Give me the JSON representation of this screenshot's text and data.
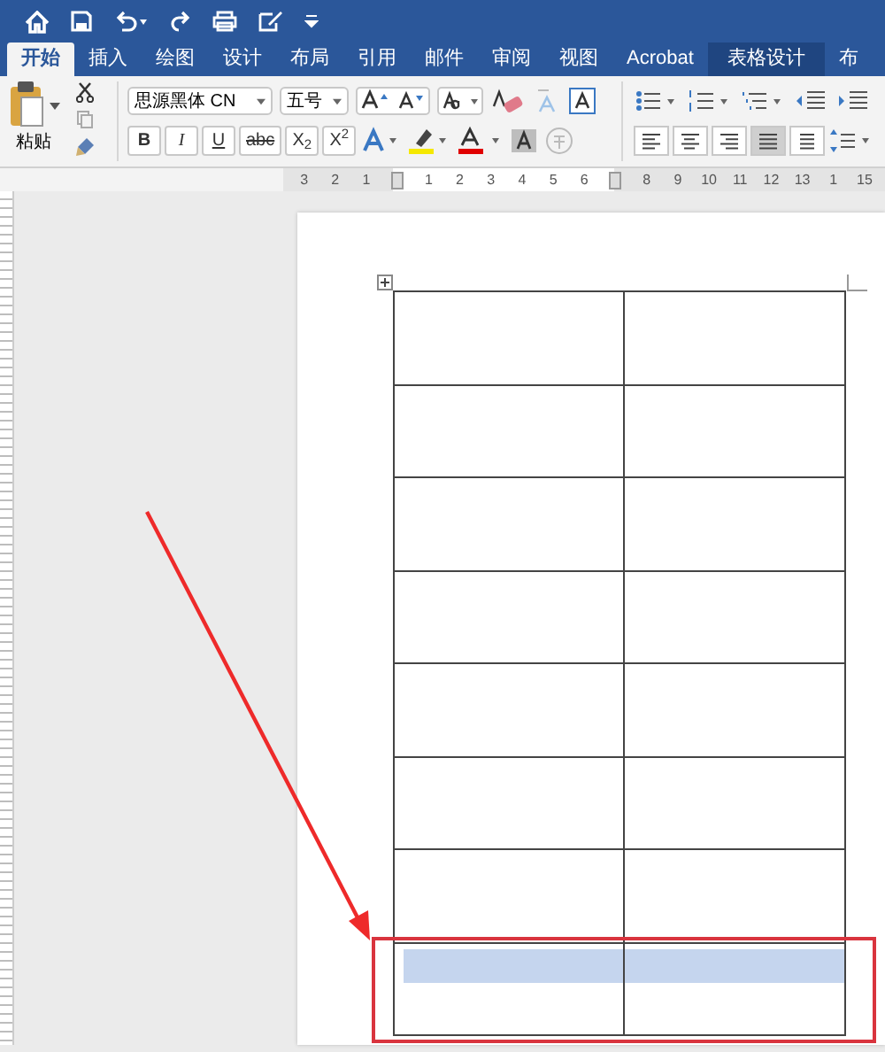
{
  "tabs": [
    {
      "label": "开始",
      "selected": true,
      "kind": "normal"
    },
    {
      "label": "插入",
      "selected": false,
      "kind": "normal"
    },
    {
      "label": "绘图",
      "selected": false,
      "kind": "normal"
    },
    {
      "label": "设计",
      "selected": false,
      "kind": "normal"
    },
    {
      "label": "布局",
      "selected": false,
      "kind": "normal"
    },
    {
      "label": "引用",
      "selected": false,
      "kind": "normal"
    },
    {
      "label": "邮件",
      "selected": false,
      "kind": "normal"
    },
    {
      "label": "审阅",
      "selected": false,
      "kind": "normal"
    },
    {
      "label": "视图",
      "selected": false,
      "kind": "normal"
    },
    {
      "label": "Acrobat",
      "selected": false,
      "kind": "normal"
    },
    {
      "label": "表格设计",
      "selected": false,
      "kind": "contextual"
    },
    {
      "label": "布",
      "selected": false,
      "kind": "normal"
    }
  ],
  "ribbon": {
    "paste_label": "粘贴",
    "font_name": "思源黑体 CN",
    "font_size": "五号",
    "format_buttons": [
      {
        "label": "B",
        "kind": "bold"
      },
      {
        "label": "I",
        "kind": "italic"
      },
      {
        "label": "U",
        "kind": "underline"
      },
      {
        "label": "abc",
        "kind": "strike"
      },
      {
        "label": "X$_{2}$",
        "kind": "plain"
      },
      {
        "label": "X$^{2}$",
        "kind": "plain"
      }
    ],
    "align_buttons": [
      {
        "kind": "left",
        "selected": false
      },
      {
        "kind": "center",
        "selected": false
      },
      {
        "kind": "right",
        "selected": false
      },
      {
        "kind": "justify",
        "selected": true
      },
      {
        "kind": "distributed",
        "selected": false
      }
    ]
  },
  "ruler": [
    {
      "kind": "number",
      "text": "3"
    },
    {
      "kind": "number",
      "text": "2"
    },
    {
      "kind": "number",
      "text": "1"
    },
    {
      "kind": "marker"
    },
    {
      "kind": "number",
      "text": "1"
    },
    {
      "kind": "number",
      "text": "2"
    },
    {
      "kind": "number",
      "text": "3"
    },
    {
      "kind": "number",
      "text": "4"
    },
    {
      "kind": "number",
      "text": "5"
    },
    {
      "kind": "number",
      "text": "6"
    },
    {
      "kind": "marker"
    },
    {
      "kind": "number",
      "text": "8"
    },
    {
      "kind": "number",
      "text": "9"
    },
    {
      "kind": "number",
      "text": "10"
    },
    {
      "kind": "number",
      "text": "11"
    },
    {
      "kind": "number",
      "text": "12"
    },
    {
      "kind": "number",
      "text": "13"
    },
    {
      "kind": "number",
      "text": "1"
    },
    {
      "kind": "number",
      "text": "15"
    }
  ],
  "table": {
    "rows": [
      {
        "selected": false
      },
      {
        "selected": false
      },
      {
        "selected": false
      },
      {
        "selected": false
      },
      {
        "selected": false
      },
      {
        "selected": false
      },
      {
        "selected": false
      },
      {
        "selected": true
      }
    ]
  }
}
